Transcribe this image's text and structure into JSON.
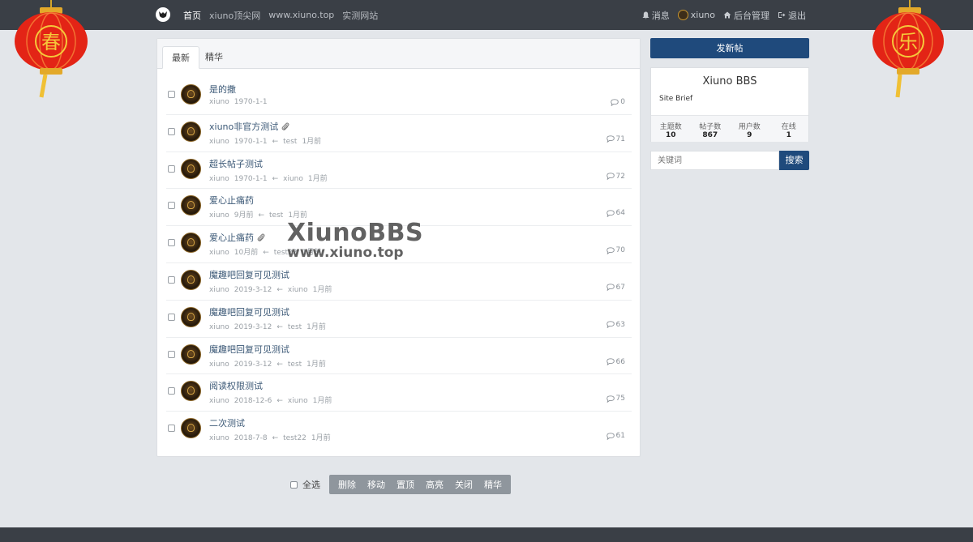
{
  "header": {
    "nav": [
      {
        "label": "首页",
        "active": true
      },
      {
        "label": "xiuno顶尖网"
      },
      {
        "label": "www.xiuno.top"
      },
      {
        "label": "实测网站"
      }
    ],
    "messages_label": "消息",
    "username": "xiuno",
    "admin_label": "后台管理",
    "logout_label": "退出"
  },
  "lanterns": {
    "left_char": "春",
    "right_char": "乐"
  },
  "tabs": [
    {
      "label": "最新",
      "active": true
    },
    {
      "label": "精华"
    }
  ],
  "threads": [
    {
      "title": "是的撒",
      "attach": false,
      "author": "xiuno",
      "date": "1970-1-1",
      "last_user": "",
      "last_time": "",
      "replies": "0"
    },
    {
      "title": "xiuno非官方测试",
      "attach": true,
      "author": "xiuno",
      "date": "1970-1-1",
      "last_user": "test",
      "last_time": "1月前",
      "replies": "71"
    },
    {
      "title": "超长帖子测试",
      "attach": false,
      "author": "xiuno",
      "date": "1970-1-1",
      "last_user": "xiuno",
      "last_time": "1月前",
      "replies": "72"
    },
    {
      "title": "爱心止痛药",
      "attach": false,
      "author": "xiuno",
      "date": "9月前",
      "last_user": "test",
      "last_time": "1月前",
      "replies": "64"
    },
    {
      "title": "爱心止痛药",
      "attach": true,
      "author": "xiuno",
      "date": "10月前",
      "last_user": "test22",
      "last_time": "1月前",
      "replies": "70"
    },
    {
      "title": "魔趣吧回复可见测试",
      "attach": false,
      "author": "xiuno",
      "date": "2019-3-12",
      "last_user": "xiuno",
      "last_time": "1月前",
      "replies": "67"
    },
    {
      "title": "魔趣吧回复可见测试",
      "attach": false,
      "author": "xiuno",
      "date": "2019-3-12",
      "last_user": "test",
      "last_time": "1月前",
      "replies": "63"
    },
    {
      "title": "魔趣吧回复可见测试",
      "attach": false,
      "author": "xiuno",
      "date": "2019-3-12",
      "last_user": "test",
      "last_time": "1月前",
      "replies": "66"
    },
    {
      "title": "阅读权限测试",
      "attach": false,
      "author": "xiuno",
      "date": "2018-12-6",
      "last_user": "xiuno",
      "last_time": "1月前",
      "replies": "75"
    },
    {
      "title": "二次测试",
      "attach": false,
      "author": "xiuno",
      "date": "2018-7-8",
      "last_user": "test22",
      "last_time": "1月前",
      "replies": "61"
    }
  ],
  "reply_arrow": "←",
  "toolbar": {
    "select_all": "全选",
    "actions": [
      "删除",
      "移动",
      "置顶",
      "高亮",
      "关闭",
      "精华"
    ]
  },
  "sidebar": {
    "new_post": "发新帖",
    "site_name": "Xiuno BBS",
    "site_brief": "Site Brief",
    "stats": [
      {
        "label": "主题数",
        "value": "10"
      },
      {
        "label": "帖子数",
        "value": "867"
      },
      {
        "label": "用户数",
        "value": "9"
      },
      {
        "label": "在线",
        "value": "1"
      }
    ],
    "search_placeholder": "关键词",
    "search_button": "搜索"
  },
  "watermark": {
    "line1": "XiunoBBS",
    "line2": "www.xiuno.top"
  },
  "colors": {
    "primary": "#1f4a7c",
    "topbar": "#3a3f46",
    "lantern": "#e32416",
    "gold": "#f5c83a"
  }
}
